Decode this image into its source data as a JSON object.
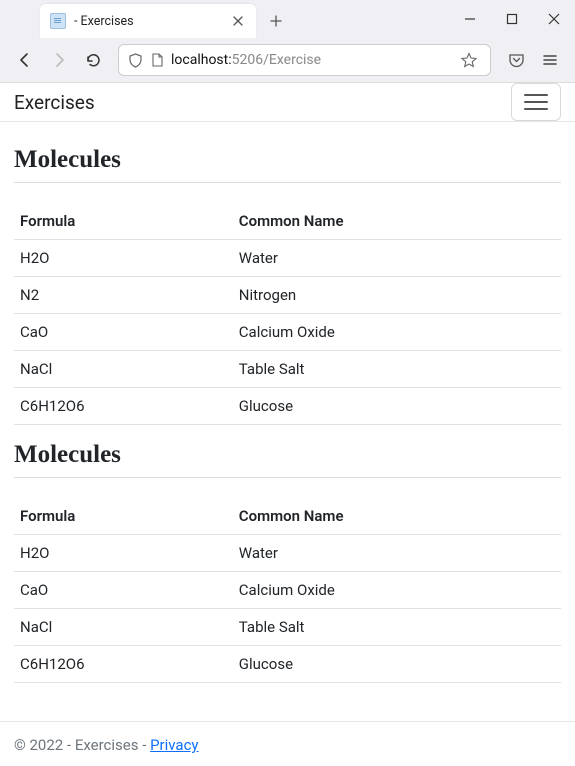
{
  "browser": {
    "tab_title": "- Exercises",
    "url_display_prefix": "localhost:",
    "url_display_port_path": "5206/Exercise"
  },
  "header": {
    "brand": "Exercises"
  },
  "sections": [
    {
      "heading": "Molecules",
      "columns": [
        "Formula",
        "Common Name"
      ],
      "rows": [
        {
          "formula": "H2O",
          "name": "Water"
        },
        {
          "formula": "N2",
          "name": "Nitrogen"
        },
        {
          "formula": "CaO",
          "name": "Calcium Oxide"
        },
        {
          "formula": "NaCl",
          "name": "Table Salt"
        },
        {
          "formula": "C6H12O6",
          "name": "Glucose"
        }
      ]
    },
    {
      "heading": "Molecules",
      "columns": [
        "Formula",
        "Common Name"
      ],
      "rows": [
        {
          "formula": "H2O",
          "name": "Water"
        },
        {
          "formula": "CaO",
          "name": "Calcium Oxide"
        },
        {
          "formula": "NaCl",
          "name": "Table Salt"
        },
        {
          "formula": "C6H12O6",
          "name": "Glucose"
        }
      ]
    }
  ],
  "footer": {
    "text": "© 2022 - Exercises - ",
    "link_label": "Privacy"
  }
}
